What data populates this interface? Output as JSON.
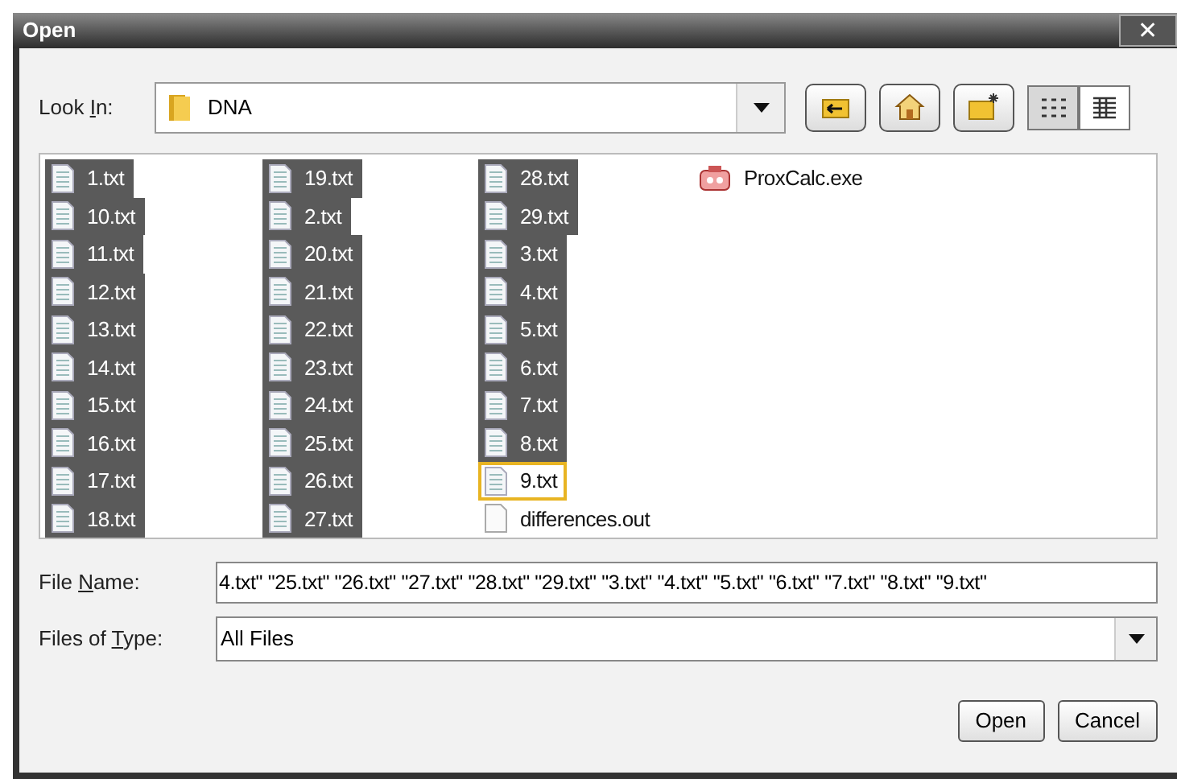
{
  "window": {
    "title": "Open",
    "close": "✕"
  },
  "look_in": {
    "label": [
      {
        "text": "Look ",
        "underlined": false
      },
      {
        "text": "I",
        "underlined": true
      },
      {
        "text": "n:",
        "underlined": false
      }
    ],
    "value": "DNA"
  },
  "toolbar": [
    {
      "kind": "up"
    },
    {
      "kind": "home"
    },
    {
      "kind": "new-folder"
    },
    {
      "kind": "list",
      "selected": true
    },
    {
      "kind": "details",
      "selected": false
    }
  ],
  "files": [
    {
      "name": "1.txt",
      "kind": "text",
      "selected": true,
      "focused": false
    },
    {
      "name": "10.txt",
      "kind": "text",
      "selected": true,
      "focused": false
    },
    {
      "name": "11.txt",
      "kind": "text",
      "selected": true,
      "focused": false
    },
    {
      "name": "12.txt",
      "kind": "text",
      "selected": true,
      "focused": false
    },
    {
      "name": "13.txt",
      "kind": "text",
      "selected": true,
      "focused": false
    },
    {
      "name": "14.txt",
      "kind": "text",
      "selected": true,
      "focused": false
    },
    {
      "name": "15.txt",
      "kind": "text",
      "selected": true,
      "focused": false
    },
    {
      "name": "16.txt",
      "kind": "text",
      "selected": true,
      "focused": false
    },
    {
      "name": "17.txt",
      "kind": "text",
      "selected": true,
      "focused": false
    },
    {
      "name": "18.txt",
      "kind": "text",
      "selected": true,
      "focused": false
    },
    {
      "name": "19.txt",
      "kind": "text",
      "selected": true,
      "focused": false
    },
    {
      "name": "2.txt",
      "kind": "text",
      "selected": true,
      "focused": false
    },
    {
      "name": "20.txt",
      "kind": "text",
      "selected": true,
      "focused": false
    },
    {
      "name": "21.txt",
      "kind": "text",
      "selected": true,
      "focused": false
    },
    {
      "name": "22.txt",
      "kind": "text",
      "selected": true,
      "focused": false
    },
    {
      "name": "23.txt",
      "kind": "text",
      "selected": true,
      "focused": false
    },
    {
      "name": "24.txt",
      "kind": "text",
      "selected": true,
      "focused": false
    },
    {
      "name": "25.txt",
      "kind": "text",
      "selected": true,
      "focused": false
    },
    {
      "name": "26.txt",
      "kind": "text",
      "selected": true,
      "focused": false
    },
    {
      "name": "27.txt",
      "kind": "text",
      "selected": true,
      "focused": false
    },
    {
      "name": "28.txt",
      "kind": "text",
      "selected": true,
      "focused": false
    },
    {
      "name": "29.txt",
      "kind": "text",
      "selected": true,
      "focused": false
    },
    {
      "name": "3.txt",
      "kind": "text",
      "selected": true,
      "focused": false
    },
    {
      "name": "4.txt",
      "kind": "text",
      "selected": true,
      "focused": false
    },
    {
      "name": "5.txt",
      "kind": "text",
      "selected": true,
      "focused": false
    },
    {
      "name": "6.txt",
      "kind": "text",
      "selected": true,
      "focused": false
    },
    {
      "name": "7.txt",
      "kind": "text",
      "selected": true,
      "focused": false
    },
    {
      "name": "8.txt",
      "kind": "text",
      "selected": true,
      "focused": false
    },
    {
      "name": "9.txt",
      "kind": "text",
      "selected": false,
      "focused": true
    },
    {
      "name": "differences.out",
      "kind": "file",
      "selected": false,
      "focused": false
    },
    {
      "name": "ProxCalc.exe",
      "kind": "program",
      "selected": false,
      "focused": false
    }
  ],
  "file_name": {
    "label": [
      {
        "text": "File ",
        "underlined": false
      },
      {
        "text": "N",
        "underlined": true
      },
      {
        "text": "ame:",
        "underlined": false
      }
    ],
    "value": "4.txt\" \"25.txt\" \"26.txt\" \"27.txt\" \"28.txt\" \"29.txt\" \"3.txt\" \"4.txt\" \"5.txt\" \"6.txt\" \"7.txt\" \"8.txt\" \"9.txt\""
  },
  "file_type": {
    "label": [
      {
        "text": "Files of ",
        "underlined": false
      },
      {
        "text": "T",
        "underlined": true
      },
      {
        "text": "ype:",
        "underlined": false
      }
    ],
    "value": "All Files"
  },
  "buttons": [
    "Open",
    "Cancel"
  ]
}
